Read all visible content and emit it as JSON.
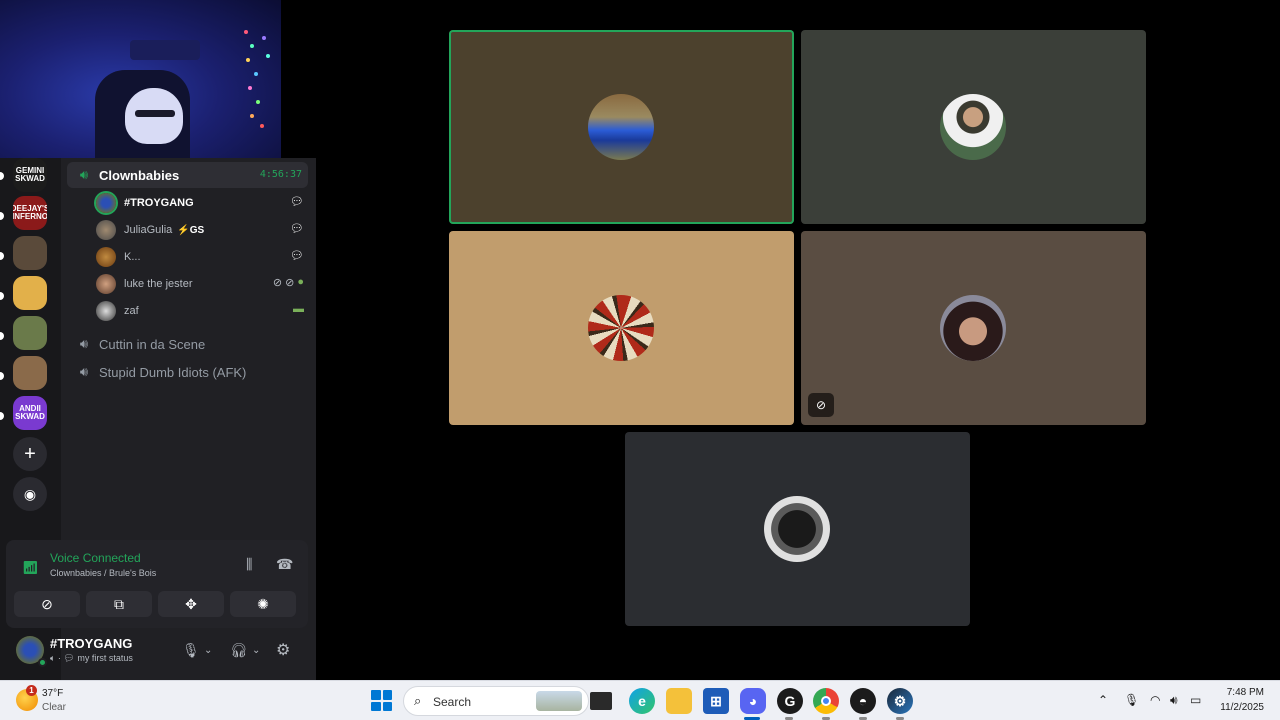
{
  "voice_channel": {
    "active": {
      "name": "Clownbabies",
      "timer": "4:56:37"
    },
    "members": [
      {
        "name": "#TROYGANG",
        "badge": "",
        "extra": ""
      },
      {
        "name": "JuliaGulia",
        "badge": "⚡GS",
        "extra": ""
      },
      {
        "name": "K...",
        "badge": "",
        "extra": ""
      },
      {
        "name": "luke the jester",
        "badge": "",
        "extra": ""
      },
      {
        "name": "zaf",
        "badge": "",
        "extra": ""
      }
    ],
    "other_channels": [
      "Cuttin in da Scene",
      "Stupid Dumb Idiots (AFK)"
    ]
  },
  "servers": [
    {
      "label": "GEMINI SKWAD",
      "color": "#1c1c1c"
    },
    {
      "label": "DEEJAY'S INFERNO",
      "color": "#8b1a1a"
    },
    {
      "label": "",
      "color": "#5a4a3a"
    },
    {
      "label": "",
      "color": "#e2b04a"
    },
    {
      "label": "",
      "color": "#6a7a4a"
    },
    {
      "label": "",
      "color": "#8a6a4a"
    },
    {
      "label": "ANDII SKWAD",
      "color": "#7a3ad0"
    }
  ],
  "voice_panel": {
    "status": "Voice Connected",
    "location": "Clownbabies / Brule's Bois"
  },
  "user_panel": {
    "name": "#TROYGANG",
    "status": "my first status"
  },
  "tiles": [
    {
      "bg": "#4c412d",
      "speaking": true,
      "muted": false,
      "avatar": "blue-car"
    },
    {
      "bg": "#3b3f39",
      "speaking": false,
      "muted": false,
      "avatar": "person-white-shirt"
    },
    {
      "bg": "#c19d6d",
      "speaking": false,
      "muted": false,
      "avatar": "red-dragon"
    },
    {
      "bg": "#5a4d42",
      "speaking": false,
      "muted": true,
      "avatar": "woman-portrait"
    },
    {
      "bg": "#2b2d31",
      "speaking": false,
      "muted": false,
      "avatar": "black-cat"
    }
  ],
  "taskbar": {
    "weather": {
      "badge": "1",
      "temp": "37°F",
      "condition": "Clear"
    },
    "search": {
      "label": "Search"
    },
    "clock": {
      "time": "7:48 PM",
      "date": "11/2/2025"
    }
  }
}
